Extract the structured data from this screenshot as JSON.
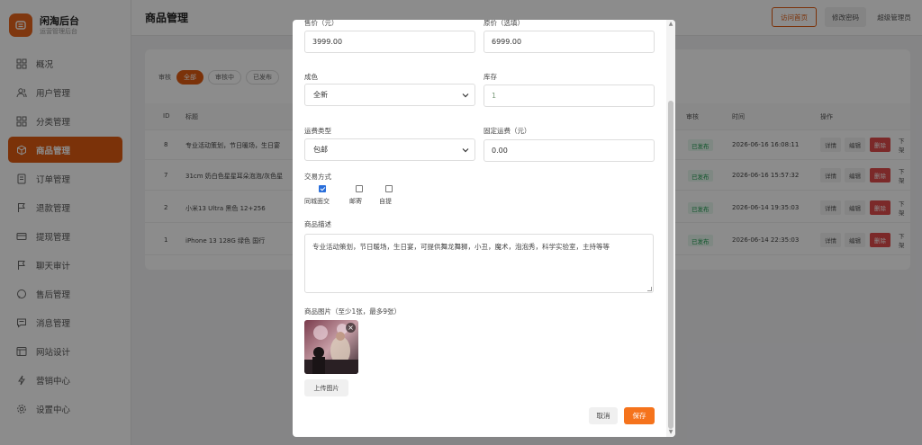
{
  "brand": {
    "title": "闲淘后台",
    "subtitle": "运营管理后台"
  },
  "sidebar": {
    "items": [
      {
        "label": "概况",
        "icon": "dashboard-icon"
      },
      {
        "label": "用户管理",
        "icon": "users-icon"
      },
      {
        "label": "分类管理",
        "icon": "grid-icon"
      },
      {
        "label": "商品管理",
        "icon": "box-icon",
        "active": true
      },
      {
        "label": "订单管理",
        "icon": "document-icon"
      },
      {
        "label": "退款管理",
        "icon": "flag-icon"
      },
      {
        "label": "提现管理",
        "icon": "card-icon"
      },
      {
        "label": "聊天审计",
        "icon": "flag-icon"
      },
      {
        "label": "售后管理",
        "icon": "chat-icon"
      },
      {
        "label": "消息管理",
        "icon": "message-icon"
      },
      {
        "label": "网站设计",
        "icon": "layout-icon"
      },
      {
        "label": "营销中心",
        "icon": "bolt-icon"
      },
      {
        "label": "设置中心",
        "icon": "gear-icon"
      }
    ]
  },
  "header": {
    "title": "商品管理",
    "visit_label": "访问首页",
    "password_label": "修改密码",
    "user_label": "超级管理员"
  },
  "filters": {
    "label": "审核",
    "chips": [
      {
        "label": "全部",
        "active": true
      },
      {
        "label": "审核中"
      },
      {
        "label": "已发布"
      }
    ]
  },
  "table": {
    "headers": {
      "id": "ID",
      "title": "标题",
      "review": "审核",
      "time": "时间",
      "actions": "操作"
    },
    "rows": [
      {
        "id": "8",
        "title": "专业活动策划，节日暖场，生日宴",
        "status": "已发布",
        "time": "2026-06-16 16:08:11"
      },
      {
        "id": "7",
        "title": "31cm 奶白色星星耳朵泡泡/灰色星",
        "status": "已发布",
        "time": "2026-06-16 15:57:32"
      },
      {
        "id": "2",
        "title": "小米13 Ultra 黑色 12+256",
        "status": "已发布",
        "time": "2026-06-14 19:35:03"
      },
      {
        "id": "1",
        "title": "iPhone 13 128G 绿色 国行",
        "status": "已发布",
        "time": "2026-06-14 22:35:03"
      }
    ],
    "actions": {
      "detail": "详情",
      "edit": "编辑",
      "delete": "删除",
      "offline": "下架"
    }
  },
  "modal": {
    "price_label": "售价（元）",
    "price_value": "3999.00",
    "original_label": "原价（选填）",
    "original_value": "6999.00",
    "condition_label": "成色",
    "condition_value": "全新",
    "stock_label": "库存",
    "stock_value": "1",
    "shipping_label": "运费类型",
    "shipping_value": "包邮",
    "fixed_fee_label": "固定运费（元）",
    "fixed_fee_value": "0.00",
    "trade_label": "交易方式",
    "trade_options": [
      {
        "label": "同城面交",
        "checked": true
      },
      {
        "label": "邮寄",
        "checked": false
      },
      {
        "label": "自提",
        "checked": false
      }
    ],
    "desc_label": "商品描述",
    "desc_value": "专业活动策划，节日暖场，生日宴，可提供舞龙舞狮，小丑，魔术，泡泡秀，科学实验室，主持等等",
    "images_label": "商品图片（至少1张，最多9张）",
    "upload_label": "上传图片",
    "cancel_label": "取消",
    "save_label": "保存"
  },
  "colors": {
    "accent": "#e05c12",
    "save": "#f5731c",
    "danger": "#e14b4b",
    "success": "#1a9a4c"
  }
}
